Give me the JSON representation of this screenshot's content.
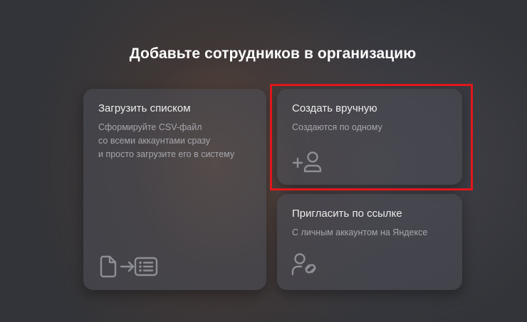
{
  "page": {
    "title": "Добавьте сотрудников в организацию"
  },
  "cards": {
    "upload": {
      "title": "Загрузить списком",
      "desc_lines": [
        "Сформируйте CSV-файл",
        "со всеми аккаунтами сразу",
        "и просто загрузите его в систему"
      ],
      "icon": "file-to-list-icon"
    },
    "manual": {
      "title": "Создать вручную",
      "desc_lines": [
        "Создаются по одному"
      ],
      "icon": "add-user-icon"
    },
    "invite": {
      "title": "Пригласить по ссылке",
      "desc_lines": [
        "С личным аккаунтом на Яндексе"
      ],
      "icon": "user-link-icon"
    }
  },
  "colors": {
    "highlight": "#e1171c",
    "icon": "#8e8f96"
  }
}
